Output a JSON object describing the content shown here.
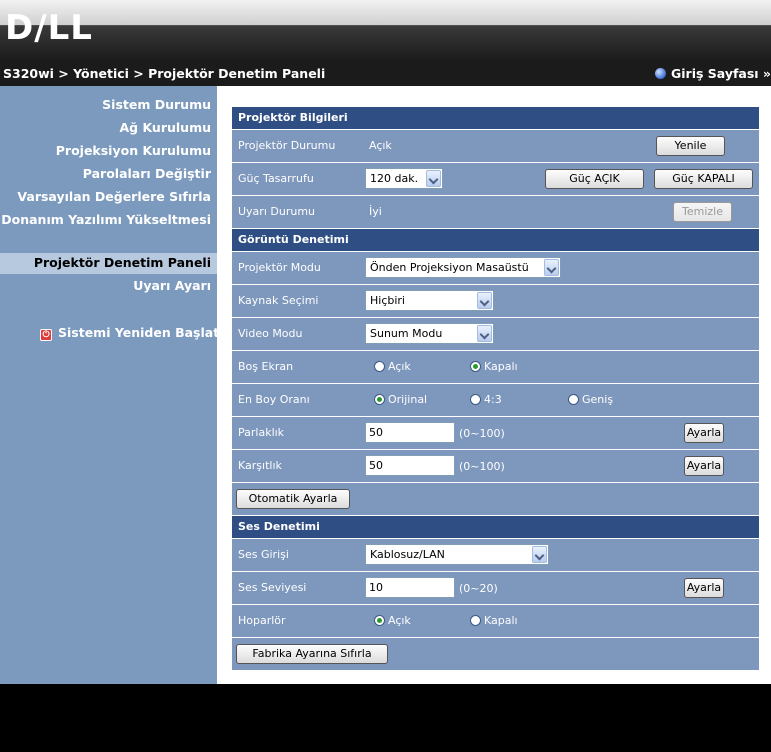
{
  "logo": "D∕LL",
  "breadcrumb": "S320wi > Yönetici > Projektör Denetim Paneli",
  "home_link": "Giriş Sayfası »",
  "sidebar": {
    "items": [
      {
        "label": "Sistem Durumu"
      },
      {
        "label": "Ağ Kurulumu"
      },
      {
        "label": "Projeksiyon Kurulumu"
      },
      {
        "label": "Parolaları Değiştir"
      },
      {
        "label": "Varsayılan Değerlere Sıfırla"
      },
      {
        "label": "Donanım Yazılımı Yükseltmesi"
      },
      {
        "label": "Projektör Denetim Paneli"
      },
      {
        "label": "Uyarı Ayarı"
      }
    ],
    "restart": "Sistemi Yeniden Başlat"
  },
  "info": {
    "title": "Projektör Bilgileri",
    "status_label": "Projektör Durumu",
    "status_value": "Açık",
    "refresh_btn": "Yenile",
    "power_save_label": "Güç Tasarrufu",
    "power_save_value": "120 dak.",
    "power_on_btn": "Güç AÇIK",
    "power_off_btn": "Güç KAPALI",
    "warning_label": "Uyarı Durumu",
    "warning_value": "İyi",
    "clear_btn": "Temizle"
  },
  "image": {
    "title": "Görüntü Denetimi",
    "mode_label": "Projektör Modu",
    "mode_value": "Önden Projeksiyon Masaüstü",
    "source_label": "Kaynak Seçimi",
    "source_value": "Hiçbiri",
    "video_label": "Video Modu",
    "video_value": "Sunum Modu",
    "blank_label": "Boş Ekran",
    "blank_on": "Açık",
    "blank_off": "Kapalı",
    "aspect_label": "En Boy Oranı",
    "aspect_original": "Orijinal",
    "aspect_43": "4:3",
    "aspect_wide": "Geniş",
    "brightness_label": "Parlaklık",
    "brightness_value": "50",
    "brightness_range": "(0~100)",
    "contrast_label": "Karşıtlık",
    "contrast_value": "50",
    "contrast_range": "(0~100)",
    "set_btn": "Ayarla",
    "auto_btn": "Otomatik Ayarla"
  },
  "audio": {
    "title": "Ses Denetimi",
    "input_label": "Ses Girişi",
    "input_value": "Kablosuz/LAN",
    "volume_label": "Ses Seviyesi",
    "volume_value": "10",
    "volume_range": "(0~20)",
    "speaker_label": "Hoparlör",
    "speaker_on": "Açık",
    "speaker_off": "Kapalı",
    "factory_btn": "Fabrika Ayarına Sıfırla"
  }
}
